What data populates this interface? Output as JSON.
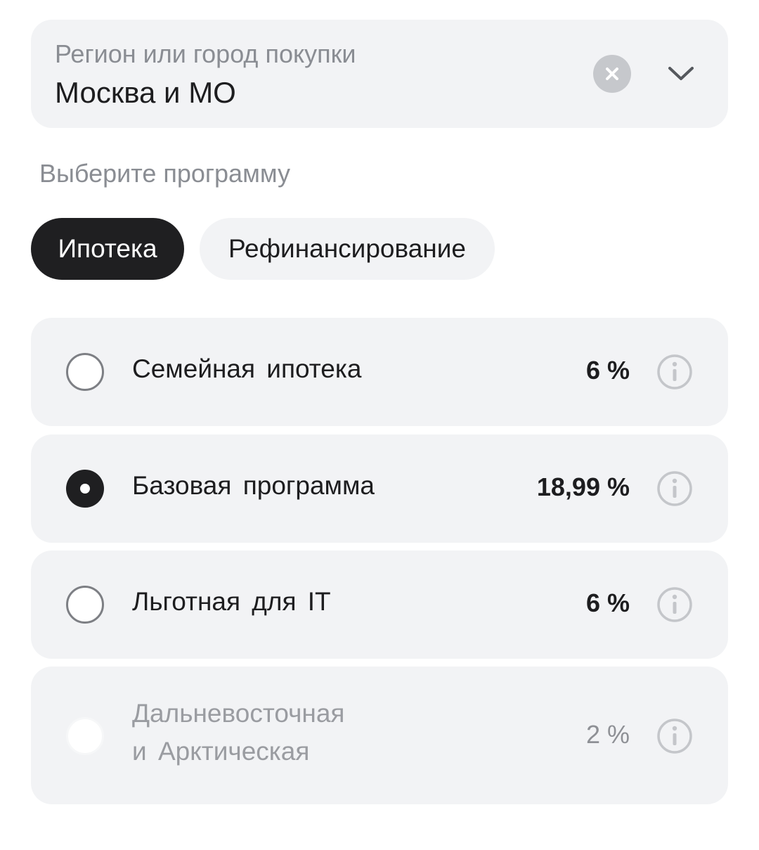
{
  "region": {
    "label": "Регион или город покупки",
    "value": "Москва и МО",
    "clear_icon": "close-icon",
    "expand_icon": "chevron-down-icon"
  },
  "program_section": {
    "label": "Выберите программу"
  },
  "tabs": [
    {
      "label": "Ипотека",
      "selected": true
    },
    {
      "label": "Рефинансирование",
      "selected": false
    }
  ],
  "programs": [
    {
      "title": "Семейная ипотека",
      "rate": "6 %",
      "selected": false,
      "disabled": false,
      "info_icon": "info-icon"
    },
    {
      "title": "Базовая программа",
      "rate": "18,99 %",
      "selected": true,
      "disabled": false,
      "info_icon": "info-icon"
    },
    {
      "title": "Льготная для IT",
      "rate": "6 %",
      "selected": false,
      "disabled": false,
      "info_icon": "info-icon"
    },
    {
      "title_line1": "Дальневосточная",
      "title_line2": "и Арктическая",
      "rate": "2 %",
      "selected": false,
      "disabled": true,
      "info_icon": "info-icon"
    }
  ],
  "colors": {
    "field_bg": "#f2f3f5",
    "active_tab_bg": "#1f1f21",
    "muted_text": "#8a8d93",
    "primary_text": "#1d1d1f"
  }
}
